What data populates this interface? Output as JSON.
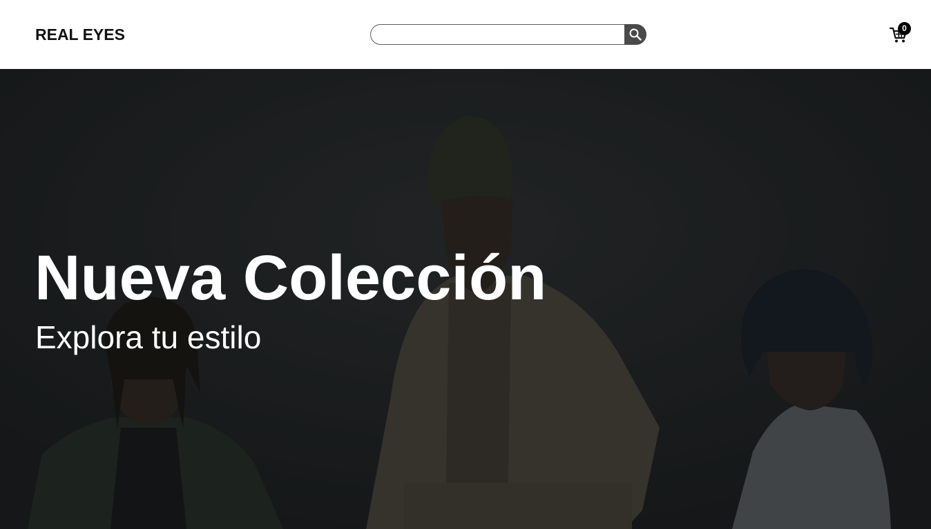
{
  "header": {
    "logo": "REAL EYES",
    "search": {
      "value": "",
      "placeholder": "",
      "icon": "search-icon"
    },
    "cart": {
      "icon": "cart-icon",
      "count": "0"
    }
  },
  "hero": {
    "title": "Nueva Colección",
    "subtitle": "Explora tu estilo",
    "image": "photo of three young men posing against a dark studio background"
  },
  "colors": {
    "header_bg": "#ffffff",
    "hero_bg": "#1d1f21",
    "search_button": "#4a4a4a",
    "badge": "#000000",
    "hero_text": "#ffffff"
  }
}
